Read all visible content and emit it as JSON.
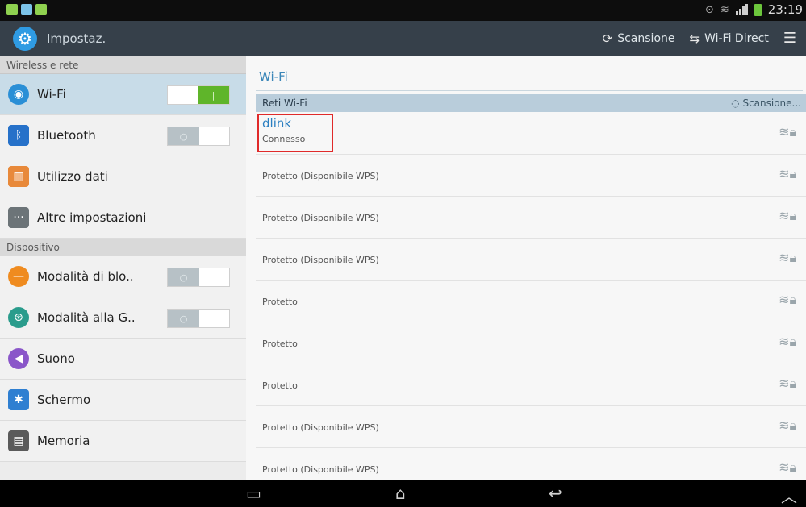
{
  "status_bar": {
    "time": "23:19",
    "icons": [
      "notification-icon",
      "gallery-icon",
      "message-icon",
      "alarm-icon",
      "wifi-signal-icon",
      "cell-signal-icon",
      "battery-icon"
    ]
  },
  "action_bar": {
    "title": "Impostaz.",
    "scan_label": "Scansione",
    "wifi_direct_label": "Wi-Fi Direct"
  },
  "left": {
    "sections": [
      {
        "header": "Wireless e rete"
      },
      {
        "header": "Dispositivo"
      }
    ],
    "items": [
      {
        "label": "Wi-Fi",
        "icon": "wifi-icon",
        "toggle": "on"
      },
      {
        "label": "Bluetooth",
        "icon": "bluetooth-icon",
        "toggle": "off"
      },
      {
        "label": "Utilizzo dati",
        "icon": "data-usage-icon"
      },
      {
        "label": "Altre impostazioni",
        "icon": "more-settings-icon"
      },
      {
        "label": "Modalità di blo..",
        "icon": "blocking-mode-icon",
        "toggle": "off"
      },
      {
        "label": "Modalità alla G..",
        "icon": "driving-mode-icon",
        "toggle": "off"
      },
      {
        "label": "Suono",
        "icon": "sound-icon"
      },
      {
        "label": "Schermo",
        "icon": "display-icon"
      },
      {
        "label": "Memoria",
        "icon": "storage-icon"
      }
    ]
  },
  "right": {
    "title": "Wi-Fi",
    "list_header": "Reti Wi-Fi",
    "scanning_label": "Scansione...",
    "networks": [
      {
        "ssid": "dlink",
        "status": "Connesso"
      },
      {
        "ssid": "",
        "status": "Protetto (Disponibile WPS)"
      },
      {
        "ssid": "",
        "status": "Protetto (Disponibile WPS)"
      },
      {
        "ssid": "",
        "status": "Protetto (Disponibile WPS)"
      },
      {
        "ssid": "",
        "status": "Protetto"
      },
      {
        "ssid": "",
        "status": "Protetto"
      },
      {
        "ssid": "",
        "status": "Protetto"
      },
      {
        "ssid": "",
        "status": "Protetto (Disponibile WPS)"
      },
      {
        "ssid": "",
        "status": "Protetto (Disponibile WPS)"
      }
    ]
  },
  "colors": {
    "action_bar": "#36404a",
    "accent_blue": "#2b7fc1",
    "toggle_on": "#5fb52a",
    "highlight_box": "#e02a2a"
  }
}
